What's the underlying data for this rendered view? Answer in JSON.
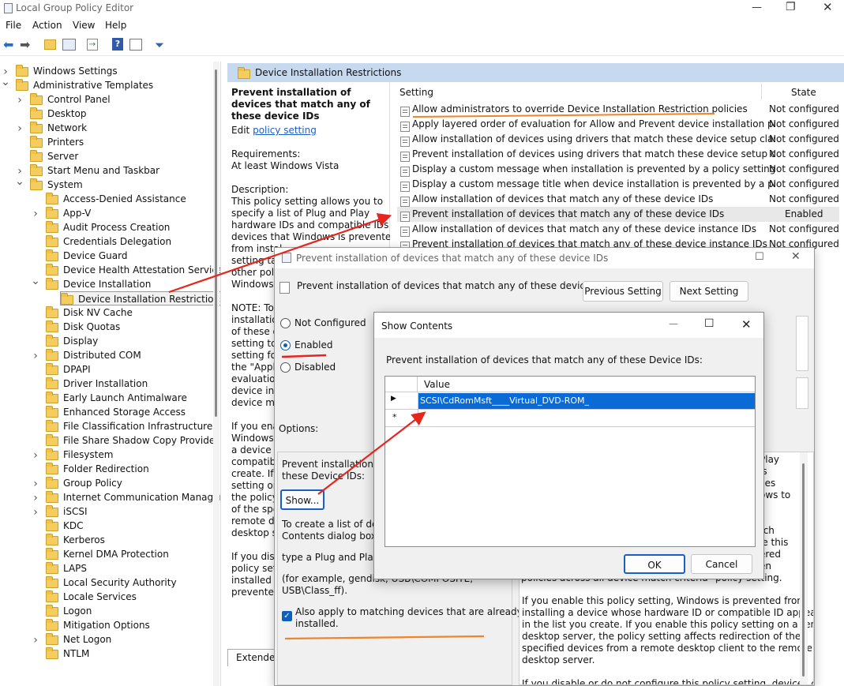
{
  "window": {
    "title": "Local Group Policy Editor"
  },
  "menu": [
    "File",
    "Action",
    "View",
    "Help"
  ],
  "tree": [
    {
      "label": "Windows Settings",
      "indent": 0,
      "chevron": ">"
    },
    {
      "label": "Administrative Templates",
      "indent": 0,
      "chevron": "v"
    },
    {
      "label": "Control Panel",
      "indent": 1,
      "chevron": ">"
    },
    {
      "label": "Desktop",
      "indent": 1,
      "chevron": ""
    },
    {
      "label": "Network",
      "indent": 1,
      "chevron": ">"
    },
    {
      "label": "Printers",
      "indent": 1,
      "chevron": ""
    },
    {
      "label": "Server",
      "indent": 1,
      "chevron": ""
    },
    {
      "label": "Start Menu and Taskbar",
      "indent": 1,
      "chevron": ">"
    },
    {
      "label": "System",
      "indent": 1,
      "chevron": "v"
    },
    {
      "label": "Access-Denied Assistance",
      "indent": 2,
      "chevron": ""
    },
    {
      "label": "App-V",
      "indent": 2,
      "chevron": ">"
    },
    {
      "label": "Audit Process Creation",
      "indent": 2,
      "chevron": ""
    },
    {
      "label": "Credentials Delegation",
      "indent": 2,
      "chevron": ""
    },
    {
      "label": "Device Guard",
      "indent": 2,
      "chevron": ""
    },
    {
      "label": "Device Health Attestation Service",
      "indent": 2,
      "chevron": ""
    },
    {
      "label": "Device Installation",
      "indent": 2,
      "chevron": "v"
    },
    {
      "label": "Device Installation Restrictions",
      "indent": 3,
      "chevron": "",
      "selected": true
    },
    {
      "label": "Disk NV Cache",
      "indent": 2,
      "chevron": ""
    },
    {
      "label": "Disk Quotas",
      "indent": 2,
      "chevron": ""
    },
    {
      "label": "Display",
      "indent": 2,
      "chevron": ""
    },
    {
      "label": "Distributed COM",
      "indent": 2,
      "chevron": ">"
    },
    {
      "label": "DPAPI",
      "indent": 2,
      "chevron": ""
    },
    {
      "label": "Driver Installation",
      "indent": 2,
      "chevron": ""
    },
    {
      "label": "Early Launch Antimalware",
      "indent": 2,
      "chevron": ""
    },
    {
      "label": "Enhanced Storage Access",
      "indent": 2,
      "chevron": ""
    },
    {
      "label": "File Classification Infrastructure",
      "indent": 2,
      "chevron": ""
    },
    {
      "label": "File Share Shadow Copy Provider",
      "indent": 2,
      "chevron": ""
    },
    {
      "label": "Filesystem",
      "indent": 2,
      "chevron": ">"
    },
    {
      "label": "Folder Redirection",
      "indent": 2,
      "chevron": ""
    },
    {
      "label": "Group Policy",
      "indent": 2,
      "chevron": ">"
    },
    {
      "label": "Internet Communication Managem",
      "indent": 2,
      "chevron": ">"
    },
    {
      "label": "iSCSI",
      "indent": 2,
      "chevron": ">"
    },
    {
      "label": "KDC",
      "indent": 2,
      "chevron": ""
    },
    {
      "label": "Kerberos",
      "indent": 2,
      "chevron": ""
    },
    {
      "label": "Kernel DMA Protection",
      "indent": 2,
      "chevron": ""
    },
    {
      "label": "LAPS",
      "indent": 2,
      "chevron": ""
    },
    {
      "label": "Local Security Authority",
      "indent": 2,
      "chevron": ""
    },
    {
      "label": "Locale Services",
      "indent": 2,
      "chevron": ""
    },
    {
      "label": "Logon",
      "indent": 2,
      "chevron": ""
    },
    {
      "label": "Mitigation Options",
      "indent": 2,
      "chevron": ""
    },
    {
      "label": "Net Logon",
      "indent": 2,
      "chevron": ">"
    },
    {
      "label": "NTLM",
      "indent": 2,
      "chevron": ""
    }
  ],
  "details": {
    "header": "Device Installation Restrictions",
    "policy_title": "Prevent installation of devices that match any of these device IDs",
    "edit_prefix": "Edit",
    "edit_link": "policy setting",
    "requirements_label": "Requirements:",
    "requirements_value": "At least Windows Vista",
    "description_label": "Description:",
    "description_lines": [
      "This policy setting allows you to",
      "specify a list of Plug and Play",
      "hardware IDs and compatible IDs for",
      "devices that Windows is prevented",
      "from instal",
      "setting tal",
      "other polic",
      "Windows t",
      "",
      "NOTE: To",
      "installatio",
      "of these d",
      "setting to",
      "setting for",
      "the \"Apply",
      "evaluation",
      "device ins",
      "device ma",
      "",
      "If you ena",
      "Windows",
      "a device w",
      "compatibl",
      "create. If y",
      "setting on",
      "the policy",
      "of the spe",
      "remote de",
      "desktop se",
      "",
      "If you disa",
      "policy sett",
      "installed a",
      "prevented"
    ],
    "tab_extended": "Extended"
  },
  "list": {
    "col_setting": "Setting",
    "col_state": "State",
    "rows": [
      {
        "setting": "Allow administrators to override Device Installation Restriction policies",
        "state": "Not configured"
      },
      {
        "setting": "Apply layered order of evaluation for Allow and Prevent device installation policie...",
        "state": "Not configured"
      },
      {
        "setting": "Allow installation of devices using drivers that match these device setup classes",
        "state": "Not configured"
      },
      {
        "setting": "Prevent installation of devices using drivers that match these device setup classes",
        "state": "Not configured"
      },
      {
        "setting": "Display a custom message when installation is prevented by a policy setting",
        "state": "Not configured"
      },
      {
        "setting": "Display a custom message title when device installation is prevented by a policy s...",
        "state": "Not configured"
      },
      {
        "setting": "Allow installation of devices that match any of these device IDs",
        "state": "Not configured"
      },
      {
        "setting": "Prevent installation of devices that match any of these device IDs",
        "state": "Enabled",
        "selected": true
      },
      {
        "setting": "Allow installation of devices that match any of these device instance IDs",
        "state": "Not configured"
      },
      {
        "setting": "Prevent installation of devices that match any of these device instance IDs",
        "state": "Not configured"
      }
    ]
  },
  "policy_dialog": {
    "title": "Prevent installation of devices that match any of these device IDs",
    "heading": "Prevent installation of devices that match any of these device IDs",
    "previous_button": "Previous Setting",
    "next_button": "Next Setting",
    "radio_not_configured": "Not Configured",
    "radio_enabled": "Enabled",
    "radio_disabled": "Disabled",
    "options_label": "Options:",
    "options_text_lines": [
      "Prevent installation of",
      "these Device IDs:"
    ],
    "show_button": "Show...",
    "help_lines_a": [
      "To create a list of devic",
      "Contents dialog box, in"
    ],
    "help_lines_b": [
      "type a Plug and Play har"
    ],
    "help_lines_c": [
      "(for example, gendisk, USB\\COMPOSITE,",
      "USB\\Class_ff)."
    ],
    "checkbox_label_lines": [
      "Also apply to matching devices that are already",
      "installed."
    ],
    "right_help_a": [
      "If you enable this policy setting, Windows is prevented from",
      "installing a device whose hardware ID or compatible ID appears",
      "in the list you create. If you enable this policy setting on a remote",
      "desktop server, the policy setting affects redirection of the",
      "specified devices from a remote desktop client to the remote",
      "desktop server."
    ],
    "right_help_b": "If you disable or do not configure this policy setting, devices can",
    "right_fragment_lines": [
      "Play",
      "is",
      "ces",
      "ows to",
      "",
      "",
      "tch",
      "le this",
      "ered",
      "en",
      "policies across all device match criteria\" policy setting."
    ]
  },
  "show_contents": {
    "title": "Show Contents",
    "prompt": "Prevent installation of devices that match any of these Device IDs:",
    "col_value": "Value",
    "rows": [
      "SCSI\\CdRomMsft____Virtual_DVD-ROM_",
      ""
    ],
    "ok": "OK",
    "cancel": "Cancel"
  },
  "colors": {
    "selection": "#0a6ad6",
    "annotation_red": "#e8241c",
    "annotation_orange": "#f0842a"
  }
}
